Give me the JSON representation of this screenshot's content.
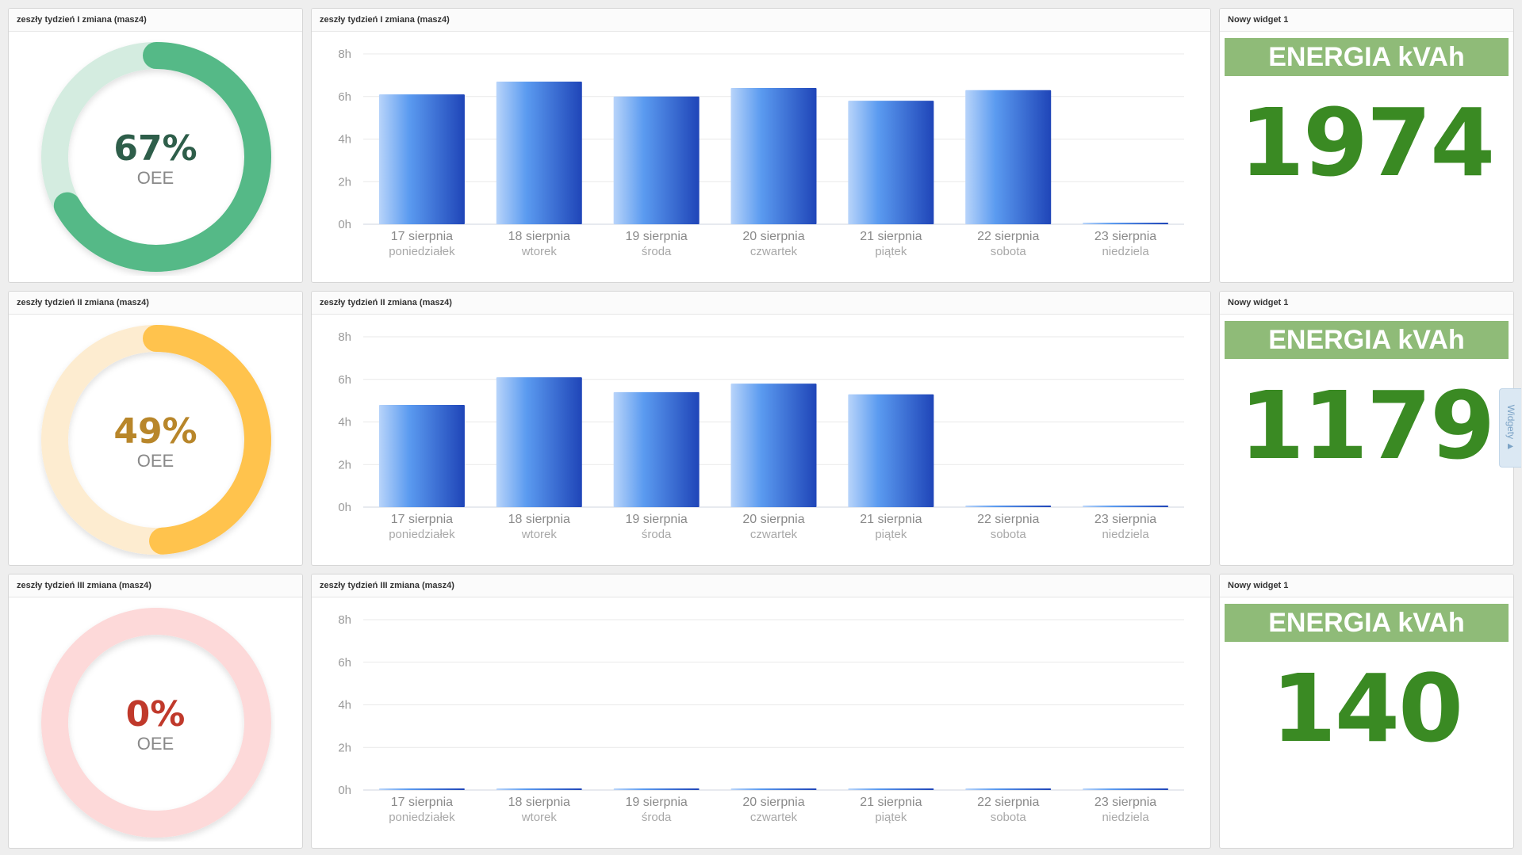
{
  "rows": [
    {
      "gauge": {
        "title": "zeszły tydzień I zmiana (masz4)",
        "value_text": "67%",
        "value": 0.67,
        "label": "OEE",
        "color": "#55b987",
        "track": "#d4ece0",
        "text_color": "#2e5e4a"
      },
      "chart": {
        "title": "zeszły tydzień I zmiana (masz4)"
      },
      "energy": {
        "title": "Nowy widget 1",
        "banner": "ENERGIA kVAh",
        "value": "1974"
      }
    },
    {
      "gauge": {
        "title": "zeszły tydzień II zmiana (masz4)",
        "value_text": "49%",
        "value": 0.49,
        "label": "OEE",
        "color": "#ffc34d",
        "track": "#fdecd0",
        "text_color": "#b8862a"
      },
      "chart": {
        "title": "zeszły tydzień II zmiana (masz4)"
      },
      "energy": {
        "title": "Nowy widget 1",
        "banner": "ENERGIA kVAh",
        "value": "1179"
      }
    },
    {
      "gauge": {
        "title": "zeszły tydzień III zmiana (masz4)",
        "value_text": "0%",
        "value": 0,
        "label": "OEE",
        "color": "#f26b6b",
        "track": "#fdd9d9",
        "text_color": "#c0392b"
      },
      "chart": {
        "title": "zeszły tydzień III zmiana (masz4)"
      },
      "energy": {
        "title": "Nowy widget 1",
        "banner": "ENERGIA kVAh",
        "value": "140"
      }
    }
  ],
  "side_tab": {
    "label": "Widgety ▲"
  },
  "chart_data": [
    {
      "type": "bar",
      "title": "zeszły tydzień I zmiana (masz4)",
      "categories": [
        "17 sierpnia",
        "18 sierpnia",
        "19 sierpnia",
        "20 sierpnia",
        "21 sierpnia",
        "22 sierpnia",
        "23 sierpnia"
      ],
      "subcategories": [
        "poniedziałek",
        "wtorek",
        "środa",
        "czwartek",
        "piątek",
        "sobota",
        "niedziela"
      ],
      "values": [
        6.1,
        6.7,
        6.0,
        6.4,
        5.8,
        6.3,
        0.05
      ],
      "ylim": [
        0,
        8
      ],
      "yticks": [
        "0h",
        "2h",
        "4h",
        "6h",
        "8h"
      ],
      "grid": true
    },
    {
      "type": "bar",
      "title": "zeszły tydzień II zmiana (masz4)",
      "categories": [
        "17 sierpnia",
        "18 sierpnia",
        "19 sierpnia",
        "20 sierpnia",
        "21 sierpnia",
        "22 sierpnia",
        "23 sierpnia"
      ],
      "subcategories": [
        "poniedziałek",
        "wtorek",
        "środa",
        "czwartek",
        "piątek",
        "sobota",
        "niedziela"
      ],
      "values": [
        4.8,
        6.1,
        5.4,
        5.8,
        5.3,
        0.05,
        0.05
      ],
      "ylim": [
        0,
        8
      ],
      "yticks": [
        "0h",
        "2h",
        "4h",
        "6h",
        "8h"
      ],
      "grid": true
    },
    {
      "type": "bar",
      "title": "zeszły tydzień III zmiana (masz4)",
      "categories": [
        "17 sierpnia",
        "18 sierpnia",
        "19 sierpnia",
        "20 sierpnia",
        "21 sierpnia",
        "22 sierpnia",
        "23 sierpnia"
      ],
      "subcategories": [
        "poniedziałek",
        "wtorek",
        "środa",
        "czwartek",
        "piątek",
        "sobota",
        "niedziela"
      ],
      "values": [
        0.05,
        0.05,
        0.05,
        0.05,
        0.05,
        0.05,
        0.05
      ],
      "ylim": [
        0,
        8
      ],
      "yticks": [
        "0h",
        "2h",
        "4h",
        "6h",
        "8h"
      ],
      "grid": true
    }
  ]
}
